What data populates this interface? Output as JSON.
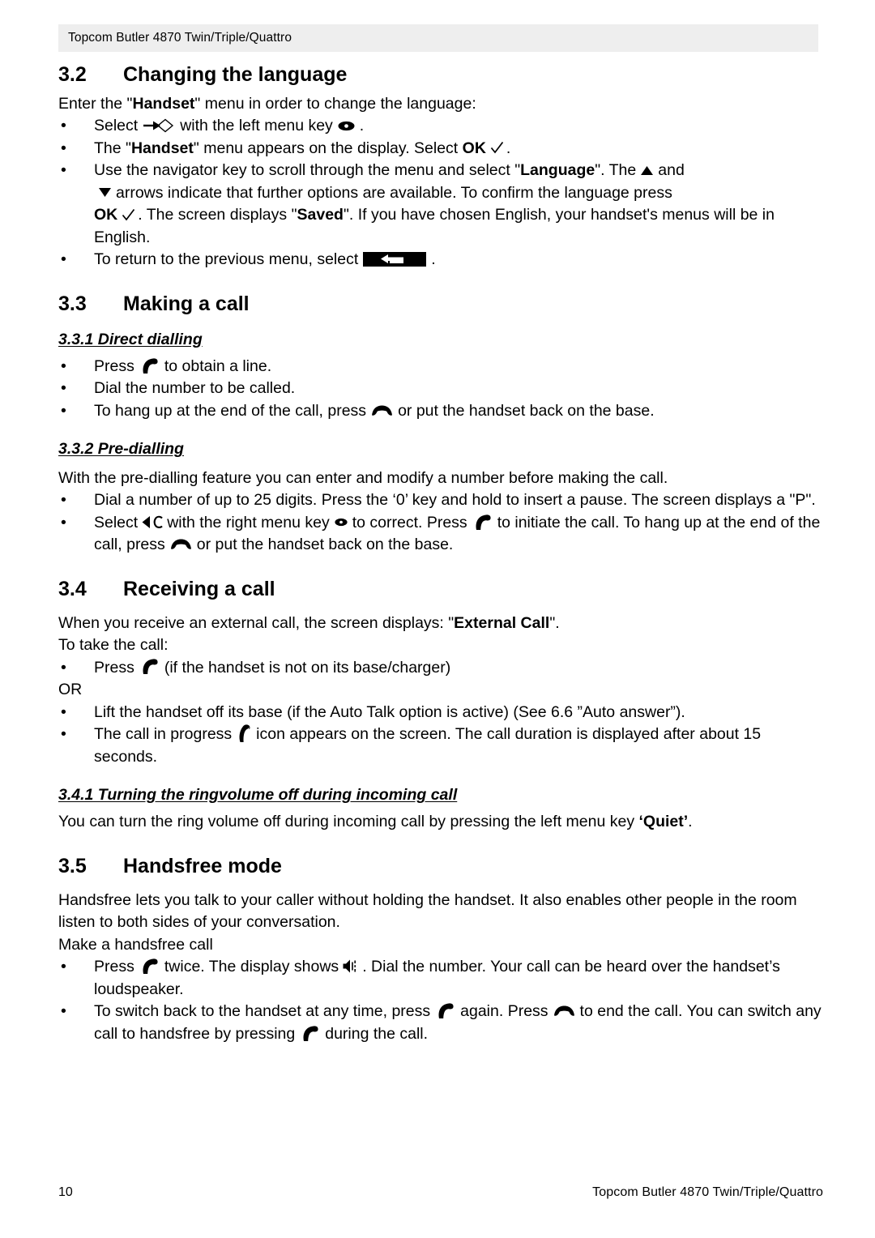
{
  "document": {
    "running_header": "Topcom Butler 4870 Twin/Triple/Quattro",
    "footer_page_number": "10",
    "footer_title": "Topcom Butler 4870 Twin/Triple/Quattro",
    "text_color": "#000000",
    "header_band_color": "#eeeeee",
    "page_background": "#ffffff"
  },
  "sections": {
    "s32": {
      "number": "3.2",
      "title": "Changing the language",
      "intro_a": "Enter the \"",
      "intro_b": "Handset",
      "intro_c": "\" menu in order to change the language:",
      "b1_a": "Select",
      "b1_b": "with the left menu key",
      "b1_c": ".",
      "b2_a": "The \"",
      "b2_b": "Handset",
      "b2_c": "\" menu appears on the display. Select ",
      "b2_d": "OK",
      "b2_e": ".",
      "b3_a": "Use the navigator key to scroll through the menu and select \"",
      "b3_b": "Language",
      "b3_c": "\". The",
      "b3_d": "and",
      "b3_e": "arrows indicate that further options are available. To confirm the language press",
      "b3_f": "OK",
      "b3_g": ". The screen displays \"",
      "b3_h": "Saved",
      "b3_i": "\". If you have chosen English, your handset's menus will be in English.",
      "b4_a": "To return to the previous menu, select",
      "b4_b": "."
    },
    "s33": {
      "number": "3.3",
      "title": "Making a call",
      "sub1": {
        "label": "3.3.1 Direct dialling",
        "b1_a": "Press",
        "b1_b": "to obtain a line.",
        "b2": "Dial the number to be called.",
        "b3_a": "To hang up at the end of the call, press",
        "b3_b": "or put the handset back on the base."
      },
      "sub2": {
        "label": "3.3.2 Pre-dialling",
        "intro": "With the pre-dialling feature you can enter and modify a number before making the call.",
        "b1": "Dial a number of up to 25 digits. Press the ‘0’ key and hold to insert a pause. The screen displays a \"P\".",
        "b2_a": "Select",
        "b2_b": "with the right menu key",
        "b2_c": "to correct. Press",
        "b2_d": "to initiate the call. To hang up at the end of the call, press",
        "b2_e": "or put the handset back on the base."
      }
    },
    "s34": {
      "number": "3.4",
      "title": "Receiving a call",
      "intro_a": "When you receive an external call, the screen displays: \"",
      "intro_b": "External Call",
      "intro_c": "\".",
      "intro_d": "To take the call:",
      "b1_a": "Press",
      "b1_b": "(if the handset is not on its base/charger)",
      "or_label": "OR",
      "b2": "Lift the handset off its base (if the Auto Talk option is active) (See 6.6 ”Auto answer”).",
      "b3_a": "The call in progress",
      "b3_b": "icon appears on the screen. The call duration is displayed after about 15 seconds.",
      "sub1": {
        "label": "3.4.1 Turning the ringvolume off during incoming call",
        "para_a": "You can turn the ring volume off during incoming call by pressing the left menu key ",
        "para_b": "‘Quiet’",
        "para_c": "."
      }
    },
    "s35": {
      "number": "3.5",
      "title": "Handsfree mode",
      "intro": "Handsfree lets you talk to your caller without holding the handset. It also enables other people in the room listen to both sides of your conversation.",
      "make_label": "Make a handsfree call",
      "b1_a": "Press",
      "b1_b": "twice. The display shows",
      "b1_c": ". Dial the number. Your call can be heard over the handset’s loudspeaker.",
      "b2_a": "To switch back to the handset at any time, press",
      "b2_b": "again. Press",
      "b2_c": "to end the call. You can switch any call to handsfree by pressing",
      "b2_d": "during the call."
    }
  },
  "icons": {
    "select_arrow_diamond": "select-arrow-diamond-icon",
    "menu_key": "menu-key-oval-icon",
    "ok_check": "checkmark-icon",
    "nav_up": "triangle-up-icon",
    "nav_down": "triangle-down-icon",
    "back_key": "back-return-key-icon",
    "off_hook": "handset-off-hook-icon",
    "on_hook": "handset-on-hook-icon",
    "clear_key": "clear-back-c-icon",
    "call_in_progress": "call-in-progress-handset-icon",
    "loudspeaker": "loudspeaker-icon"
  }
}
